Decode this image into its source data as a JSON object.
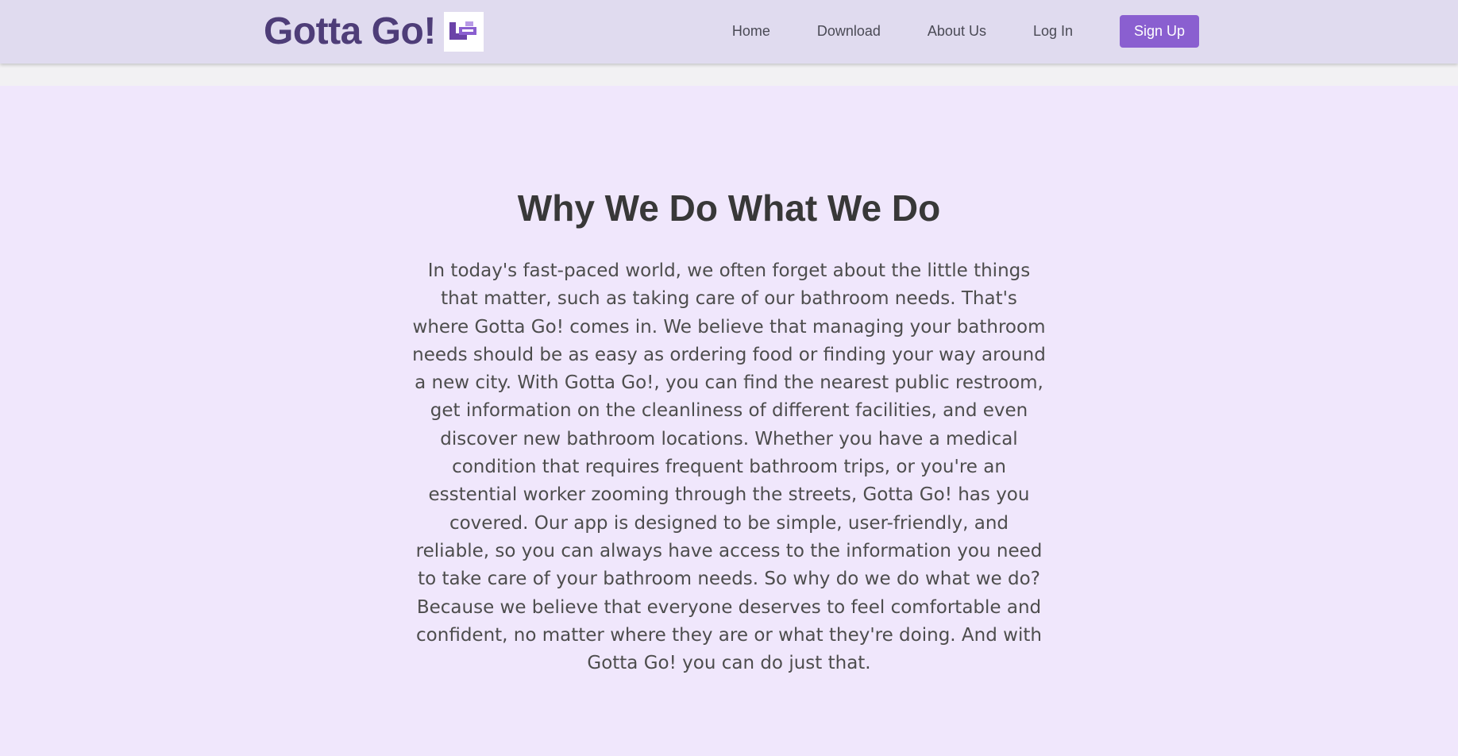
{
  "header": {
    "brand_name": "Gotta Go!",
    "logo_icon": "gotta-go-logo-icon",
    "nav": [
      {
        "label": "Home"
      },
      {
        "label": "Download"
      },
      {
        "label": "About Us"
      },
      {
        "label": "Log In"
      }
    ],
    "signup_label": "Sign Up"
  },
  "main": {
    "title": "Why We Do What We Do",
    "body": "In today's fast-paced world, we often forget about the little things that matter, such as taking care of our bathroom needs. That's where Gotta Go! comes in. We believe that managing your bathroom needs should be as easy as ordering food or finding your way around a new city. With Gotta Go!, you can find the nearest public restroom, get information on the cleanliness of different facilities, and even discover new bathroom locations. Whether you have a medical condition that requires frequent bathroom trips, or you're an esstential worker zooming through the streets, Gotta Go! has you covered. Our app is designed to be simple, user-friendly, and reliable, so you can always have access to the information you need to take care of your bathroom needs. So why do we do what we do? Because we believe that everyone deserves to feel comfortable and confident, no matter where they are or what they're doing. And with Gotta Go! you can do just that."
  },
  "colors": {
    "navbar_bg": "#e0dbef",
    "brand": "#4e3d78",
    "accent": "#8a5fd0",
    "hero_bg": "#f0e7fc",
    "heading": "#383838",
    "body_text": "#4d4d4d"
  }
}
